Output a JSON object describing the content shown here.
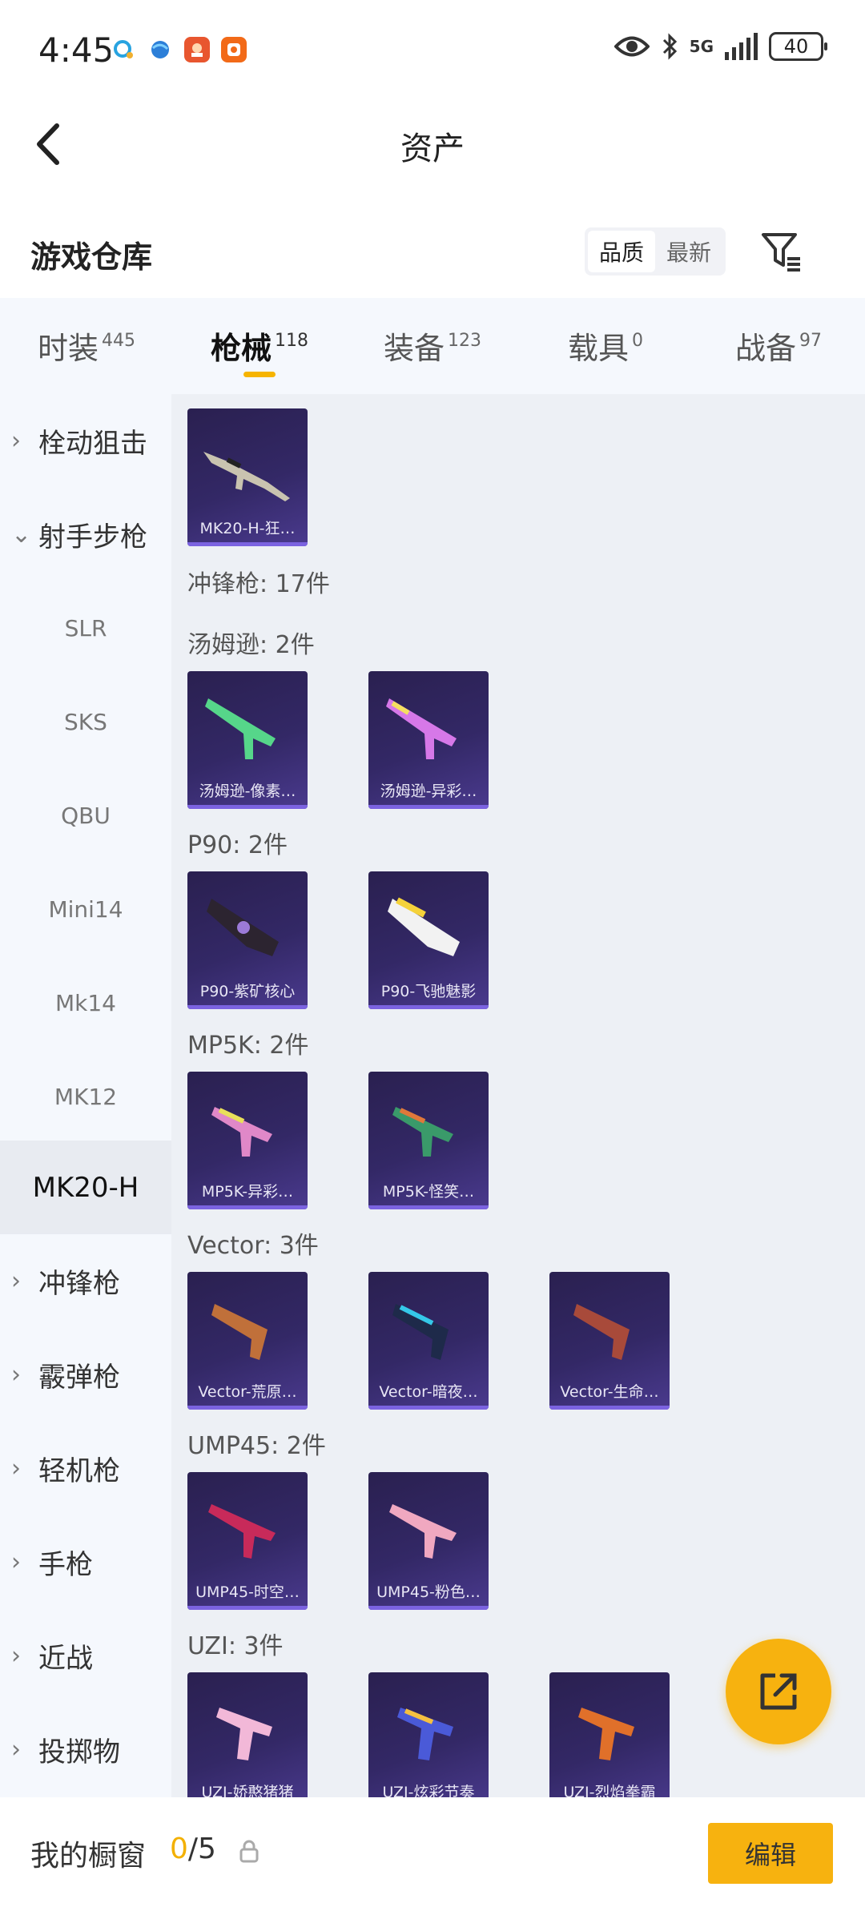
{
  "status": {
    "time": "4:45",
    "network": "5G",
    "battery": "40"
  },
  "header": {
    "title": "资产"
  },
  "section": {
    "title": "游戏仓库",
    "sort_quality": "品质",
    "sort_newest": "最新"
  },
  "tabs": [
    {
      "label": "时装",
      "count": "445"
    },
    {
      "label": "枪械",
      "count": "118"
    },
    {
      "label": "装备",
      "count": "123"
    },
    {
      "label": "载具",
      "count": "0"
    },
    {
      "label": "战备",
      "count": "97"
    }
  ],
  "sidebar": {
    "bolt_sniper": "栓动狙击",
    "marksman": "射手步枪",
    "slr": "SLR",
    "sks": "SKS",
    "qbu": "QBU",
    "mini14": "Mini14",
    "mk14": "Mk14",
    "mk12": "MK12",
    "mk20h": "MK20-H",
    "smg": "冲锋枪",
    "shotgun": "霰弹枪",
    "lmg": "轻机枪",
    "pistol": "手枪",
    "melee": "近战",
    "throwable": "投掷物"
  },
  "main": {
    "mk20_card": "MK20-H-狂…",
    "smg_header": "冲锋枪: 17件",
    "thompson_label": "汤姆逊: 2件",
    "thompson_1": "汤姆逊-像素…",
    "thompson_2": "汤姆逊-异彩…",
    "p90_label": "P90: 2件",
    "p90_1": "P90-紫矿核心",
    "p90_2": "P90-飞驰魅影",
    "mp5k_label": "MP5K: 2件",
    "mp5k_1": "MP5K-异彩…",
    "mp5k_2": "MP5K-怪笑…",
    "vector_label": "Vector: 3件",
    "vector_1": "Vector-荒原…",
    "vector_2": "Vector-暗夜…",
    "vector_3": "Vector-生命…",
    "ump_label": "UMP45: 2件",
    "ump_1": "UMP45-时空…",
    "ump_2": "UMP45-粉色…",
    "uzi_label": "UZI: 3件",
    "uzi_1": "UZI-娇憨猪猪",
    "uzi_2": "UZI-炫彩节奏",
    "uzi_3": "UZI-烈焰拳霸"
  },
  "bottom": {
    "window_label": "我的橱窗",
    "count_current": "0",
    "count_total": "/5",
    "edit_label": "编辑"
  },
  "colors": {
    "accent": "#f7b20f",
    "card_bg": "#332866",
    "sidebar_bg": "#f5f8fd"
  }
}
